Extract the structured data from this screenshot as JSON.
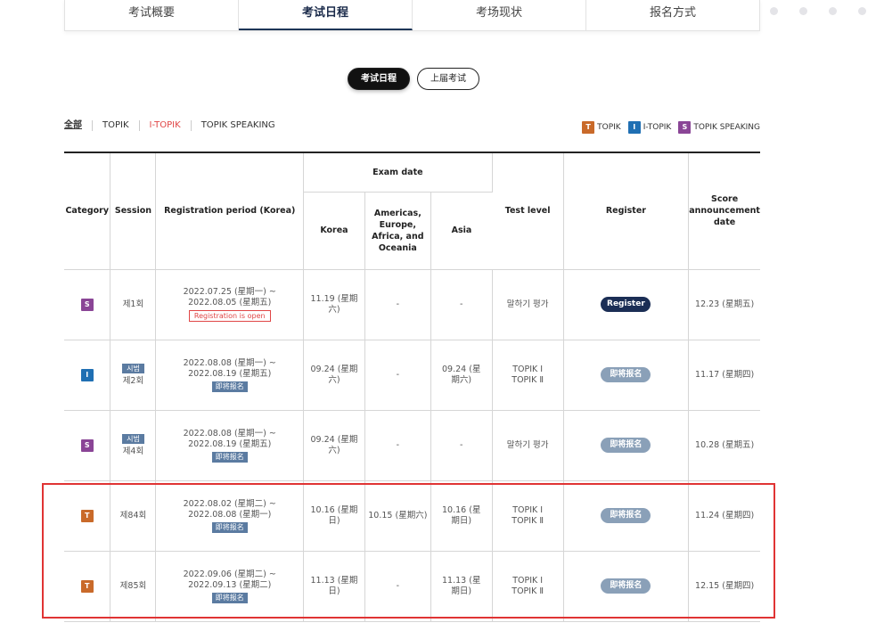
{
  "tabs": [
    "考试概要",
    "考试日程",
    "考场现状",
    "报名方式"
  ],
  "active_tab": 1,
  "pills": [
    "考试日程",
    "上届考试"
  ],
  "filters": [
    "全部",
    "TOPIK",
    "I-TOPIK",
    "TOPIK SPEAKING"
  ],
  "legend": [
    {
      "badge": "T",
      "label": "TOPIK"
    },
    {
      "badge": "I",
      "label": "I-TOPIK"
    },
    {
      "badge": "S",
      "label": "TOPIK SPEAKING"
    }
  ],
  "headers": {
    "category": "Category",
    "session": "Session",
    "registration": "Registration period (Korea)",
    "exam_date": "Exam date",
    "korea": "Korea",
    "americas": "Americas, Europe, Africa, and Oceania",
    "asia": "Asia",
    "level": "Test level",
    "register": "Register",
    "score": "Score announcement date"
  },
  "rows": [
    {
      "badge": "S",
      "trial": "",
      "session": "제1회",
      "reg_period": "2022.07.25 (星期一) ~ 2022.08.05 (星期五)",
      "reg_status": "Registration is open",
      "korea": "11.19 (星期六)",
      "americas": "-",
      "asia": "-",
      "level": "말하기 평가",
      "button": "Register",
      "score": "12.23 (星期五)"
    },
    {
      "badge": "I",
      "trial": "시범",
      "session": "제2회",
      "reg_period": "2022.08.08 (星期一) ~ 2022.08.19 (星期五)",
      "reg_status": "即将报名",
      "korea": "09.24 (星期六)",
      "americas": "-",
      "asia": "09.24 (星期六)",
      "level": "TOPIK Ⅰ TOPIK Ⅱ",
      "button": "即将报名",
      "score": "11.17 (星期四)"
    },
    {
      "badge": "S",
      "trial": "시범",
      "session": "제4회",
      "reg_period": "2022.08.08 (星期一) ~ 2022.08.19 (星期五)",
      "reg_status": "即将报名",
      "korea": "09.24 (星期六)",
      "americas": "-",
      "asia": "-",
      "level": "말하기 평가",
      "button": "即将报名",
      "score": "10.28 (星期五)"
    },
    {
      "badge": "T",
      "trial": "",
      "session": "제84회",
      "reg_period": "2022.08.02 (星期二) ~ 2022.08.08 (星期一)",
      "reg_status": "即将报名",
      "korea": "10.16 (星期日)",
      "americas": "10.15 (星期六)",
      "asia": "10.16 (星期日)",
      "level": "TOPIK Ⅰ TOPIK Ⅱ",
      "button": "即将报名",
      "score": "11.24 (星期四)"
    },
    {
      "badge": "T",
      "trial": "",
      "session": "제85회",
      "reg_period": "2022.09.06 (星期二) ~ 2022.09.13 (星期二)",
      "reg_status": "即将报名",
      "korea": "11.13 (星期日)",
      "americas": "-",
      "asia": "11.13 (星期日)",
      "level": "TOPIK Ⅰ TOPIK Ⅱ",
      "button": "即将报名",
      "score": "12.15 (星期四)"
    }
  ],
  "colors": {
    "accent": "#1b2e55",
    "highlight": "#e03434",
    "badge_t": "#c96a2a",
    "badge_i": "#1f6fb3",
    "badge_s": "#8a4596"
  }
}
